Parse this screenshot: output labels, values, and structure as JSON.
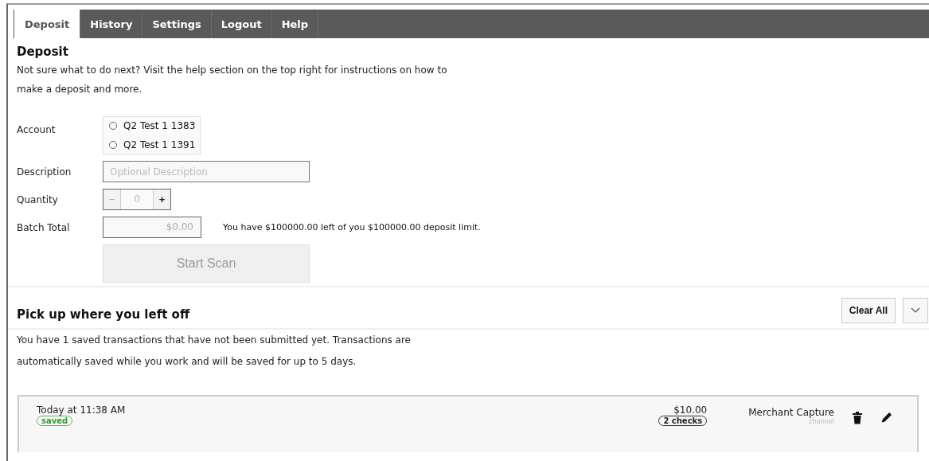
{
  "tabs": [
    {
      "label": "Deposit",
      "selected": true
    },
    {
      "label": "History",
      "selected": false
    },
    {
      "label": "Settings",
      "selected": false
    },
    {
      "label": "Logout",
      "selected": false
    },
    {
      "label": "Help",
      "selected": false
    }
  ],
  "deposit": {
    "title": "Deposit",
    "intro": "Not sure what to do next? Visit the help section on the top right for instructions on how to make a deposit and more.",
    "account": {
      "label": "Account",
      "options": [
        {
          "label": "Q2 Test 1 1383",
          "selected": false
        },
        {
          "label": "Q2 Test 1 1391",
          "selected": false
        }
      ]
    },
    "description": {
      "label": "Description",
      "placeholder": "Optional Description"
    },
    "quantity": {
      "label": "Quantity",
      "minus": "−",
      "value": "0",
      "plus": "+",
      "minus_disabled": true
    },
    "batch_total": {
      "label": "Batch Total",
      "value": "$0.00",
      "limit_note": "You have $100000.00 left of you $100000.00 deposit limit."
    },
    "start_button": {
      "label": "Start Scan",
      "disabled": true
    }
  },
  "saved": {
    "title": "Pick up where you left off",
    "clear_button": "Clear All",
    "intro": "You have 1 saved transactions that have not been submitted yet. Transactions are automatically saved while you work and will be saved for up to 5 days.",
    "transactions": [
      {
        "time": "Today at 11:38 AM",
        "status": "saved",
        "amount": "$10.00",
        "checks": "2 checks",
        "channel": "Merchant Capture",
        "channel_label": "channel"
      }
    ]
  }
}
